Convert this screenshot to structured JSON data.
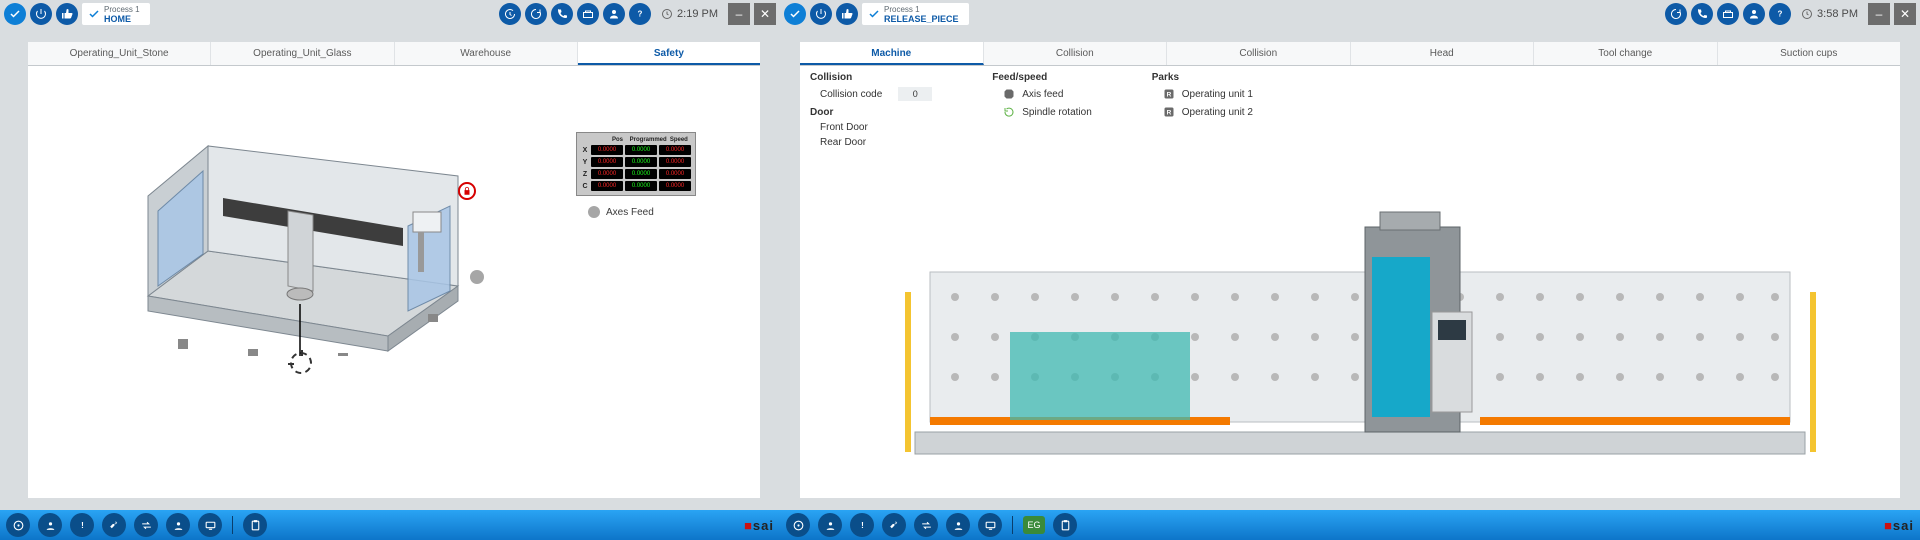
{
  "left": {
    "crumb": {
      "title": "Process 1",
      "subtitle": "HOME"
    },
    "clock": "2:19 PM",
    "tabs": [
      {
        "label": "Operating_Unit_Stone",
        "active": false
      },
      {
        "label": "Operating_Unit_Glass",
        "active": false
      },
      {
        "label": "Warehouse",
        "active": false
      },
      {
        "label": "Safety",
        "active": true
      }
    ],
    "status_headers": [
      "Pos",
      "Programmed",
      "Speed"
    ],
    "status_rows": [
      {
        "axis": "X",
        "a": "0.0000",
        "b": "0.0000",
        "c": "0.0000"
      },
      {
        "axis": "Y",
        "a": "0.0000",
        "b": "0.0000",
        "c": "0.0000"
      },
      {
        "axis": "Z",
        "a": "0.0000",
        "b": "0.0000",
        "c": "0.0000"
      },
      {
        "axis": "C",
        "a": "0.0000",
        "b": "0.0000",
        "c": "0.0000"
      }
    ],
    "axes_feed_label": "Axes Feed"
  },
  "right": {
    "crumb": {
      "title": "Process 1",
      "subtitle": "RELEASE_PIECE"
    },
    "clock": "3:58 PM",
    "tabs": [
      {
        "label": "Machine",
        "active": true
      },
      {
        "label": "Collision",
        "active": false
      },
      {
        "label": "Collision",
        "active": false
      },
      {
        "label": "Head",
        "active": false
      },
      {
        "label": "Tool change",
        "active": false
      },
      {
        "label": "Suction cups",
        "active": false
      }
    ],
    "cols": {
      "collision": {
        "h": "Collision",
        "code_label": "Collision code",
        "code_value": "0",
        "door_h": "Door",
        "doors": [
          "Front Door",
          "Rear Door"
        ]
      },
      "feed": {
        "h": "Feed/speed",
        "items": [
          "Axis feed",
          "Spindle rotation"
        ]
      },
      "parks": {
        "h": "Parks",
        "items": [
          "Operating unit 1",
          "Operating unit 2"
        ]
      }
    }
  },
  "bottom": {
    "badges": [
      "EG"
    ],
    "brand": "sai"
  }
}
